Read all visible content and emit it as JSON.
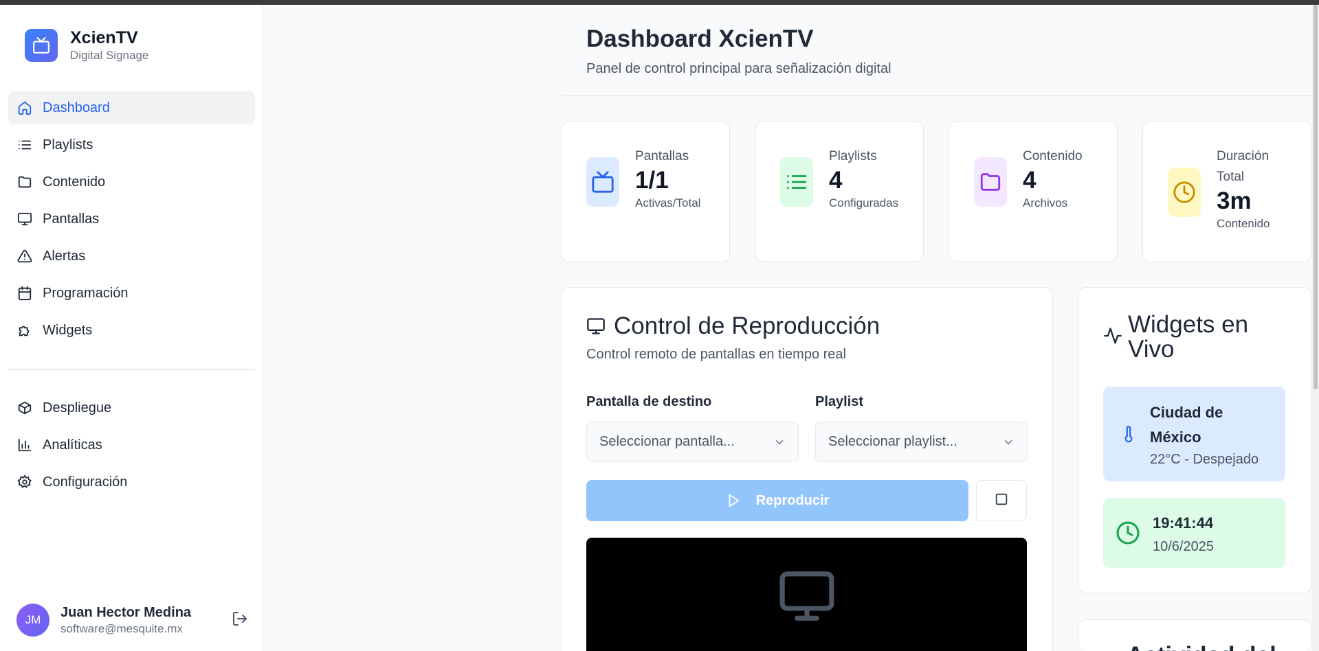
{
  "brand": {
    "name": "XcienTV",
    "subtitle": "Digital Signage"
  },
  "nav": {
    "primary": [
      {
        "label": "Dashboard",
        "icon": "home-icon",
        "active": true
      },
      {
        "label": "Playlists",
        "icon": "list-icon"
      },
      {
        "label": "Contenido",
        "icon": "folder-icon"
      },
      {
        "label": "Pantallas",
        "icon": "monitor-icon"
      },
      {
        "label": "Alertas",
        "icon": "alert-triangle-icon"
      },
      {
        "label": "Programación",
        "icon": "calendar-icon"
      },
      {
        "label": "Widgets",
        "icon": "puzzle-icon"
      }
    ],
    "secondary": [
      {
        "label": "Despliegue",
        "icon": "package-icon"
      },
      {
        "label": "Analíticas",
        "icon": "bar-chart-icon"
      },
      {
        "label": "Configuración",
        "icon": "settings-icon"
      }
    ]
  },
  "user": {
    "initials": "JM",
    "name": "Juan Hector Medina",
    "email": "software@mesquite.mx"
  },
  "header": {
    "title": "Dashboard XcienTV",
    "subtitle": "Panel de control principal para señalización digital"
  },
  "stats": [
    {
      "label": "Pantallas",
      "value": "1/1",
      "note": "Activas/Total",
      "icon": "tv-icon",
      "color": "#2563eb",
      "bg": "#dbeafe"
    },
    {
      "label": "Playlists",
      "value": "4",
      "note": "Configuradas",
      "icon": "list-icon",
      "color": "#16a34a",
      "bg": "#dcfce7"
    },
    {
      "label": "Contenido",
      "value": "4",
      "note": "Archivos",
      "icon": "folder-icon",
      "color": "#9333ea",
      "bg": "#f3e8ff"
    },
    {
      "label": "Duración Total",
      "value": "3m",
      "note": "Contenido",
      "icon": "clock-icon",
      "color": "#ca8a04",
      "bg": "#fef9c3"
    }
  ],
  "control": {
    "title": "Control de Reproducción",
    "subtitle": "Control remoto de pantallas en tiempo real",
    "screen_label": "Pantalla de destino",
    "screen_placeholder": "Seleccionar pantalla...",
    "playlist_label": "Playlist",
    "playlist_placeholder": "Seleccionar playlist...",
    "play_label": "Reproducir"
  },
  "widgets": {
    "title": "Widgets en Vivo",
    "weather": {
      "city": "Ciudad de México",
      "detail": "22°C - Despejado"
    },
    "clock": {
      "time": "19:41:44",
      "date": "10/6/2025"
    }
  },
  "activity": {
    "title": "Actividad del"
  }
}
